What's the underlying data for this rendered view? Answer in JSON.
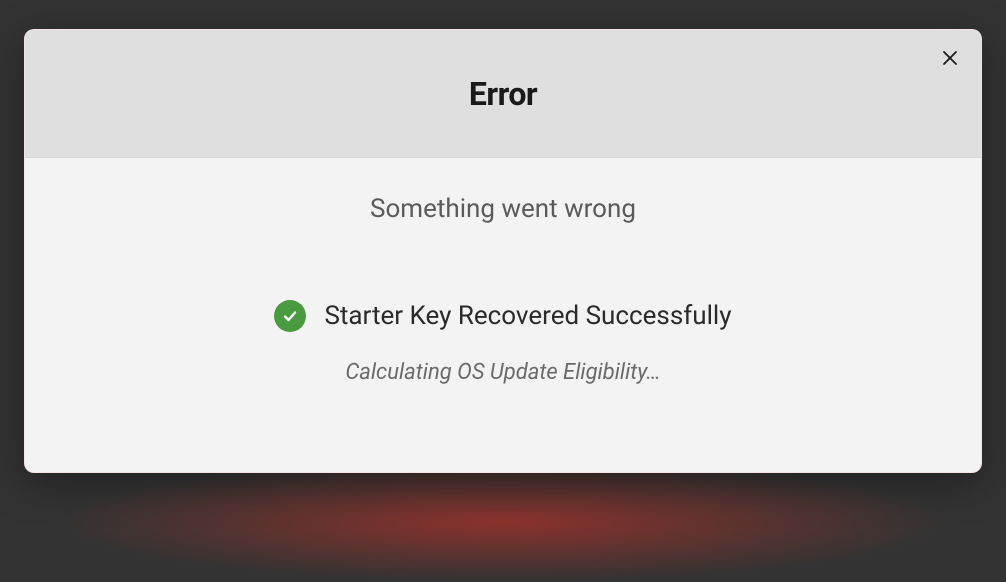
{
  "dialog": {
    "title": "Error",
    "message": "Something went wrong",
    "status": {
      "text": "Starter Key Recovered Successfully",
      "substatus": "Calculating OS Update Eligibility…"
    }
  }
}
